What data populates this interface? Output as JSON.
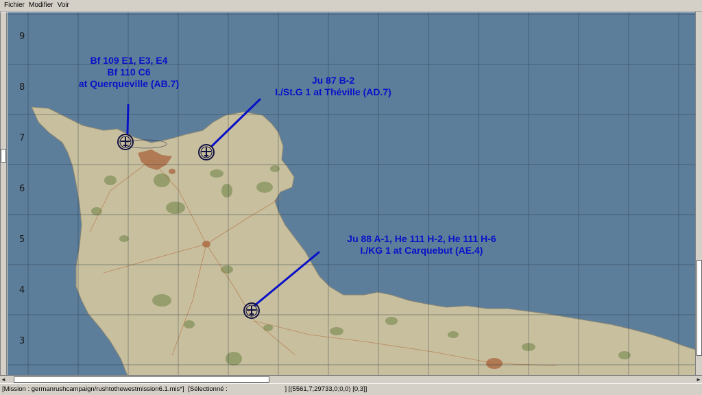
{
  "menu": {
    "items": [
      "Fichier",
      "Modifier",
      "Voir"
    ]
  },
  "map": {
    "colors": {
      "sea": "#5d7e9a",
      "land": "#c8bf9e",
      "town": "#b07a55",
      "forest": "#8f9a66",
      "grid": "#1f3040",
      "annotation": "#0a10c8",
      "airfield_ring": "#101040"
    },
    "grid_row_labels": [
      "9",
      "8",
      "7",
      "6",
      "5",
      "4",
      "3"
    ],
    "annotations": [
      {
        "lines": [
          "Bf 109 E1, E3, E4",
          "Bf 110 C6",
          "at Querqueville (AB.7)"
        ],
        "icon": "aircraft-icon"
      },
      {
        "lines": [
          "Ju 87 B-2",
          "I./St.G 1 at Théville (AD.7)"
        ],
        "icon": "aircraft-icon"
      },
      {
        "lines": [
          "Ju 88 A-1, He 111 H-2, He 111 H-6",
          "I./KG 1 at Carquebut (AE.4)"
        ],
        "icon": "aircraft-icon"
      }
    ]
  },
  "scrollbars": {
    "left_arrow": "◄",
    "right_arrow": "►"
  },
  "status": {
    "mission": "[Mission : germanrushcampaign/rushtothewestmission6.1.mis*]",
    "selection": "[Sélectionné :",
    "coords": "] [(5561,7;29733,0;0,0) [0,3]]"
  }
}
